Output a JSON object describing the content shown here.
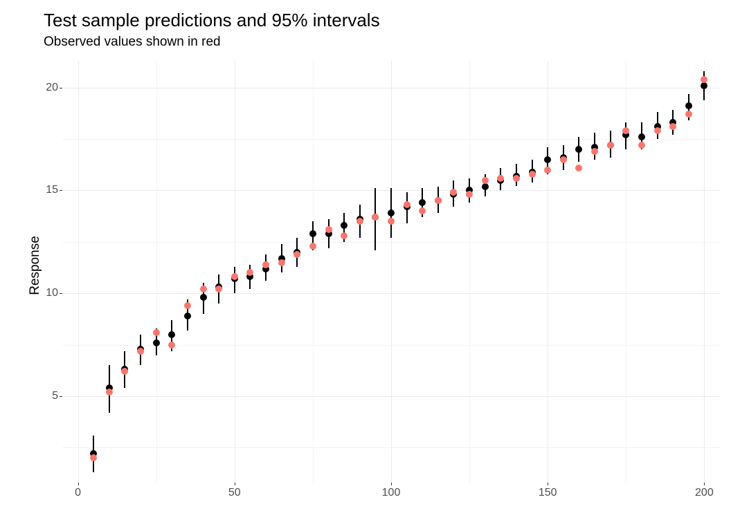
{
  "chart_data": {
    "type": "scatter",
    "title": "Test sample predictions and 95% intervals",
    "subtitle": "Observed values shown in red",
    "xlabel": "",
    "ylabel": "Response",
    "xlim": [
      -5,
      205
    ],
    "ylim": [
      0.8,
      21.3
    ],
    "x_ticks": [
      0,
      50,
      100,
      150,
      200
    ],
    "y_ticks": [
      5,
      10,
      15,
      20
    ],
    "series": [
      {
        "name": "prediction",
        "color": "#000000",
        "x": [
          5,
          10,
          15,
          20,
          25,
          30,
          35,
          40,
          45,
          50,
          55,
          60,
          65,
          70,
          75,
          80,
          85,
          90,
          95,
          100,
          105,
          110,
          115,
          120,
          125,
          130,
          135,
          140,
          145,
          150,
          155,
          160,
          165,
          170,
          175,
          180,
          185,
          190,
          195,
          200
        ],
        "y": [
          2.2,
          5.4,
          6.3,
          7.3,
          7.6,
          8.0,
          8.9,
          9.8,
          10.3,
          10.7,
          10.8,
          11.2,
          11.7,
          12.0,
          12.9,
          12.9,
          13.3,
          13.6,
          13.7,
          13.9,
          14.2,
          14.4,
          14.5,
          14.8,
          15.0,
          15.2,
          15.5,
          15.7,
          15.9,
          16.5,
          16.6,
          17.0,
          17.1,
          17.2,
          17.7,
          17.6,
          18.1,
          18.3,
          19.1,
          20.1
        ],
        "ylo": [
          1.3,
          4.2,
          5.4,
          6.5,
          7.0,
          7.2,
          8.2,
          9.0,
          9.5,
          10.0,
          10.2,
          10.6,
          11.0,
          11.3,
          12.1,
          12.2,
          12.5,
          12.7,
          12.1,
          12.7,
          13.4,
          13.7,
          13.9,
          14.2,
          14.4,
          14.7,
          15.0,
          15.2,
          15.4,
          15.8,
          16.0,
          16.4,
          16.5,
          16.6,
          17.0,
          17.0,
          17.5,
          17.7,
          18.4,
          19.4
        ],
        "yhi": [
          3.1,
          6.5,
          7.2,
          8.0,
          8.3,
          8.7,
          9.7,
          10.5,
          10.9,
          11.3,
          11.4,
          11.9,
          12.4,
          12.7,
          13.5,
          13.6,
          13.9,
          14.3,
          15.1,
          15.1,
          14.9,
          15.1,
          15.2,
          15.5,
          15.6,
          15.8,
          16.1,
          16.3,
          16.5,
          17.1,
          17.2,
          17.6,
          17.8,
          17.9,
          18.3,
          18.3,
          18.8,
          18.9,
          19.7,
          20.8
        ]
      },
      {
        "name": "observed",
        "color": "#f8766d",
        "x": [
          5,
          10,
          15,
          20,
          25,
          30,
          35,
          40,
          45,
          50,
          55,
          60,
          65,
          70,
          75,
          80,
          85,
          90,
          95,
          100,
          105,
          110,
          115,
          120,
          125,
          130,
          135,
          140,
          145,
          150,
          155,
          160,
          165,
          170,
          175,
          180,
          185,
          190,
          195,
          200
        ],
        "y": [
          2.0,
          5.2,
          6.2,
          7.2,
          8.1,
          7.5,
          9.4,
          10.2,
          10.2,
          10.8,
          11.0,
          11.4,
          11.5,
          11.9,
          12.3,
          13.1,
          12.8,
          13.5,
          13.7,
          13.5,
          14.3,
          14.0,
          14.5,
          14.9,
          14.8,
          15.5,
          15.6,
          15.6,
          15.8,
          16.0,
          16.5,
          16.1,
          16.9,
          17.2,
          17.9,
          17.2,
          17.9,
          18.1,
          18.7,
          20.4
        ]
      }
    ]
  }
}
